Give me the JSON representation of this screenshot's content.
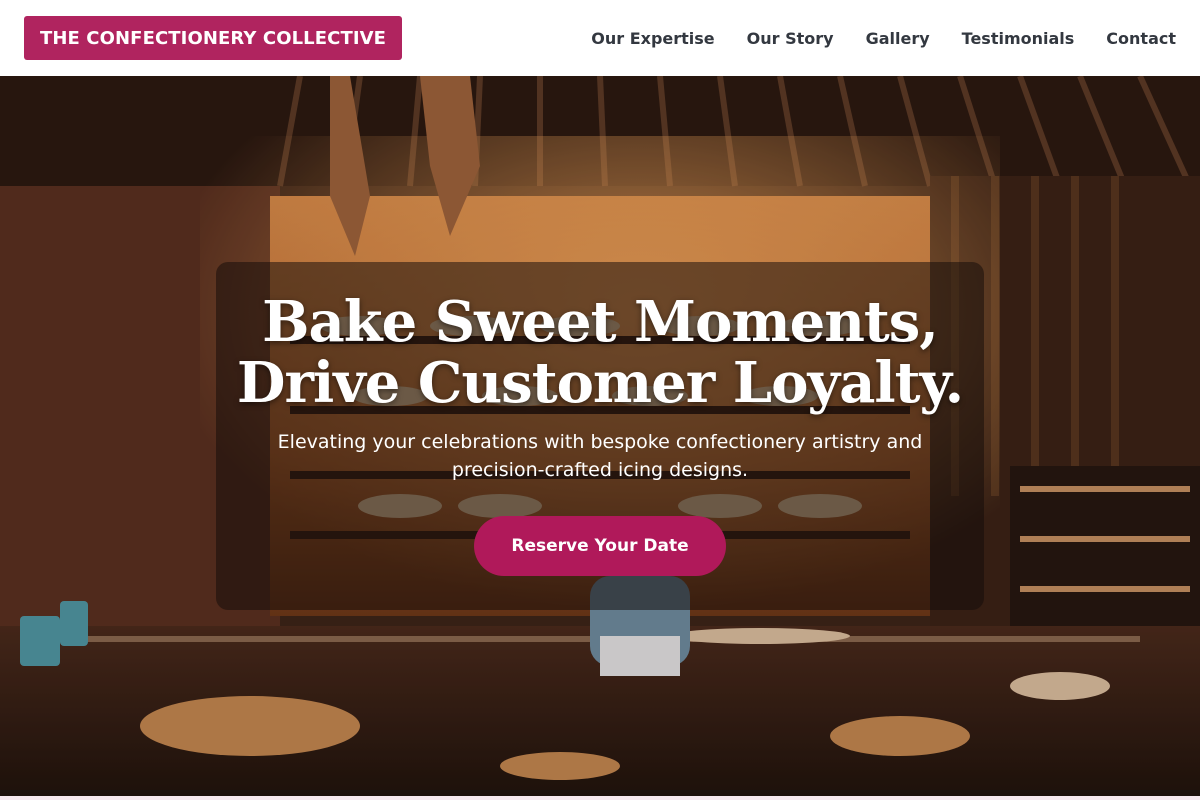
{
  "header": {
    "brand": "THE CONFECTIONERY COLLECTIVE",
    "nav": [
      {
        "label": "Our Expertise"
      },
      {
        "label": "Our Story"
      },
      {
        "label": "Gallery"
      },
      {
        "label": "Testimonials"
      },
      {
        "label": "Contact"
      }
    ]
  },
  "hero": {
    "title": "Bake Sweet Moments,\nDrive Customer Loyalty.",
    "subtitle": "Elevating your celebrations with bespoke confectionery artistry and precision-crafted icing designs.",
    "cta_label": "Reserve Your Date"
  },
  "colors": {
    "brand": "#b0245f",
    "cta": "#b0195a",
    "nav_text": "#333840"
  }
}
